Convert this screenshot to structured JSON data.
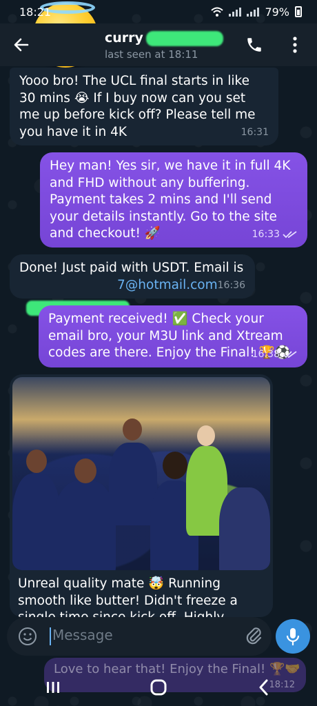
{
  "status_bar": {
    "time": "18:21",
    "battery": "79%"
  },
  "header": {
    "contact_name": "curry",
    "status": "last seen at 18:11"
  },
  "messages": [
    {
      "direction": "in",
      "text": "Yooo bro! The UCL final starts in like 30 mins 😭 If I buy now can you set me up before kick off? Please tell me you have it in 4K",
      "time": "16:31"
    },
    {
      "direction": "out",
      "text": "Hey man! Yes sir, we have it in full 4K and FHD without any buffering. Payment takes 2 mins and I'll send your details instantly. Go to the site and checkout! 🚀",
      "time": "16:33"
    },
    {
      "direction": "in",
      "text_line1": "Done! Just paid with USDT. Email is",
      "email_visible": "7@hotmail.com",
      "time": "16:36"
    },
    {
      "direction": "out",
      "text": "Payment received! ✅ Check your email bro, your M3U link and Xtream codes are there. Enjoy the Final! 🏆⚽",
      "time": "16:38"
    },
    {
      "direction": "in",
      "type": "photo",
      "caption": "Unreal quality mate 🤯 Running smooth like butter! Didn't freeze a single time since kick off. Highly recommend you"
    },
    {
      "direction": "out",
      "text": "Love to hear that! Enjoy the Final! 🏆🤝",
      "time": "18:12"
    }
  ],
  "composer": {
    "placeholder": "Message"
  },
  "colors": {
    "outgoing_bubble": "#7c4ddb",
    "incoming_bubble": "#182533",
    "accent": "#3a93e0",
    "redaction": "#3ee77a"
  },
  "icons": [
    "back-arrow-icon",
    "phone-icon",
    "more-vertical-icon",
    "emoji-icon",
    "paperclip-icon",
    "microphone-icon",
    "double-check-icon"
  ]
}
